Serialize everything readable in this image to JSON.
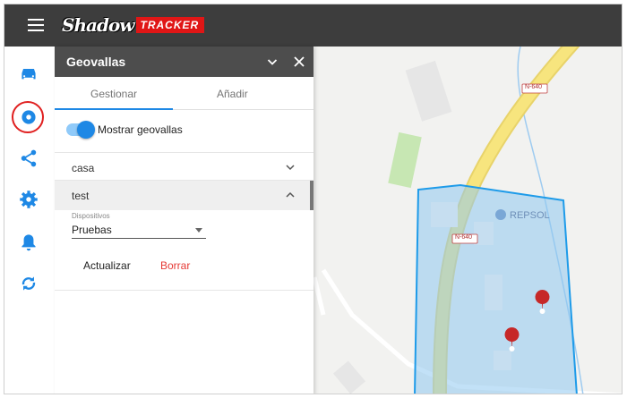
{
  "app": {
    "logo_main": "Shadow",
    "logo_sub": "TRACKER"
  },
  "rail": {
    "items": [
      {
        "icon": "car-icon",
        "active": false
      },
      {
        "icon": "geofence-icon",
        "active": true
      },
      {
        "icon": "share-icon",
        "active": false
      },
      {
        "icon": "gear-icon",
        "active": false
      },
      {
        "icon": "bell-icon",
        "active": false
      },
      {
        "icon": "sync-icon",
        "active": false
      }
    ]
  },
  "panel": {
    "title": "Geovallas",
    "tabs": [
      {
        "label": "Gestionar",
        "active": true
      },
      {
        "label": "Añadir",
        "active": false
      }
    ],
    "toggle_label": "Mostrar geovallas",
    "toggle_on": true,
    "fences": [
      {
        "name": "casa",
        "expanded": false
      },
      {
        "name": "test",
        "expanded": true
      }
    ],
    "devices_label": "Dispositivos",
    "devices_value": "Pruebas",
    "update_label": "Actualizar",
    "delete_label": "Borrar"
  },
  "map": {
    "road_label_1": "N-640",
    "road_label_2": "N-640",
    "poi_label": "REPSOL",
    "markers": 2
  },
  "colors": {
    "topbar": "#3d3d3d",
    "panel_header": "#4d4d4d",
    "accent": "#1e88e5",
    "danger": "#e53935",
    "geofence_fill": "#8fc8f0",
    "geofence_stroke": "#1e9be9",
    "road": "#f6e27a"
  }
}
